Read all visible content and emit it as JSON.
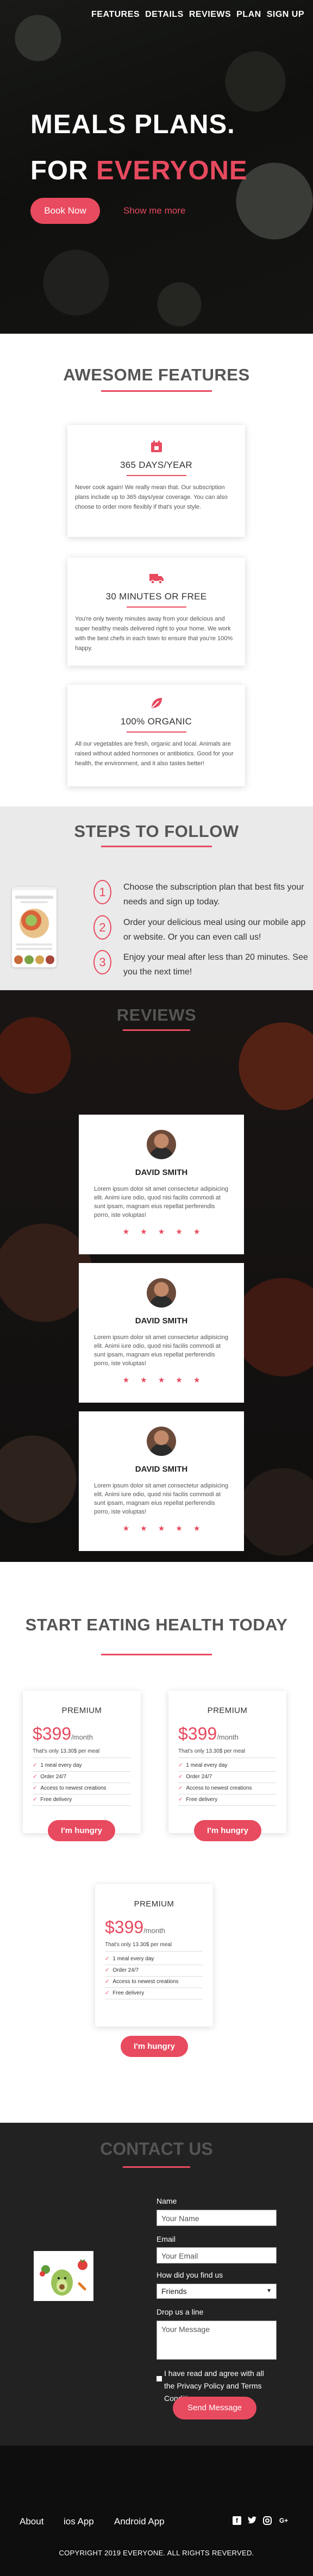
{
  "nav": [
    "FEATURES",
    "DETAILS",
    "REVIEWS",
    "PLAN",
    "SIGN UP"
  ],
  "hero": {
    "line1": "MEALS PLANS.",
    "line2_prefix": "FOR ",
    "line2_accent": "EVERYONE",
    "book_label": "Book Now",
    "more_label": "Show me more"
  },
  "features": {
    "title": "AWESOME FEATURES",
    "items": [
      {
        "icon": "calendar-icon",
        "title": "365 DAYS/YEAR",
        "text": "Never cook again! We really mean that. Our subscription plans include up to 365 days/year coverage. You can also choose to order more flexibly if that's your style."
      },
      {
        "icon": "delivery-truck-icon",
        "title": "30 MINUTES OR FREE",
        "text": "You're only twenty minutes away from your delicious and super healthy meals delivered right to your home. We work with the best chefs in each town to ensure that you're 100% happy."
      },
      {
        "icon": "leaf-icon",
        "title": "100% ORGANIC",
        "text": "All our vegetables are fresh, organic and local. Animals are raised without added hormones or antibiotics. Good for your health, the environment, and it also tastes better!"
      }
    ]
  },
  "steps": {
    "title": "STEPS TO FOLLOW",
    "items": [
      {
        "num": "1",
        "text": "Choose the subscription plan that best fits your needs and sign up today."
      },
      {
        "num": "2",
        "text": "Order your delicious meal using our mobile app or website. Or you can even call us!"
      },
      {
        "num": "3",
        "text": "Enjoy your meal after less than 20 minutes. See you the next time!"
      }
    ]
  },
  "reviews": {
    "title": "REVIEWS",
    "items": [
      {
        "name": "DAVID SMITH",
        "text": "Lorem ipsum dolor sit amet consectetur adipisicing elit. Animi iure odio, quod nisi facilis commodi at sunt ipsam, magnam eius repellat perferendis porro, iste voluptas!",
        "stars": 5
      },
      {
        "name": "DAVID SMITH",
        "text": "Lorem ipsum dolor sit amet consectetur adipisicing elit. Animi iure odio, quod nisi facilis commodi at sunt ipsam, magnam eius repellat perferendis porro, iste voluptas!",
        "stars": 5
      },
      {
        "name": "DAVID SMITH",
        "text": "Lorem ipsum dolor sit amet consectetur adipisicing elit. Animi iure odio, quod nisi facilis commodi at sunt ipsam, magnam eius repellat perferendis porro, iste voluptas!",
        "stars": 5
      }
    ]
  },
  "pricing": {
    "title": "START EATING HEALTH TODAY",
    "plans": [
      {
        "name": "PREMIUM",
        "price": "$399",
        "period": "/month",
        "per_meal": "That's only 13.30$ per meal",
        "features": [
          "1 meal every day",
          "Order 24/7",
          "Access to newest creations",
          "Free delivery"
        ],
        "cta": "I'm hungry"
      },
      {
        "name": "PREMIUM",
        "price": "$399",
        "period": "/month",
        "per_meal": "That's only 13.30$ per meal",
        "features": [
          "1 meal every day",
          "Order 24/7",
          "Access to newest creations",
          "Free delivery"
        ],
        "cta": "I'm hungry"
      },
      {
        "name": "PREMIUM",
        "price": "$399",
        "period": "/month",
        "per_meal": "That's only 13.30$ per meal",
        "features": [
          "1 meal every day",
          "Order 24/7",
          "Access to newest creations",
          "Free delivery"
        ],
        "cta": "I'm hungry"
      }
    ]
  },
  "contact": {
    "title": "CONTACT US",
    "name_label": "Name",
    "name_placeholder": "Your Name",
    "email_label": "Email",
    "email_placeholder": "Your Email",
    "find_label": "How did you find us",
    "find_selected": "Friends",
    "message_label": "Drop us a line",
    "message_placeholder": "Your Message",
    "agree_text": "I have read and agree with all the Privacy Policy and Terms Conditions",
    "send_label": "Send Message"
  },
  "footer": {
    "links": [
      "About",
      "ios App",
      "Android App"
    ],
    "social_icons": [
      "facebook-icon",
      "twitter-icon",
      "instagram-icon",
      "google-plus-icon"
    ],
    "copyright": "COPYRIGHT 2019 EVERYONE. ALL RIGHTS REVERVED."
  },
  "colors": {
    "accent": "#e84a5f",
    "dark": "#222222",
    "footer": "#0e0e0e"
  }
}
